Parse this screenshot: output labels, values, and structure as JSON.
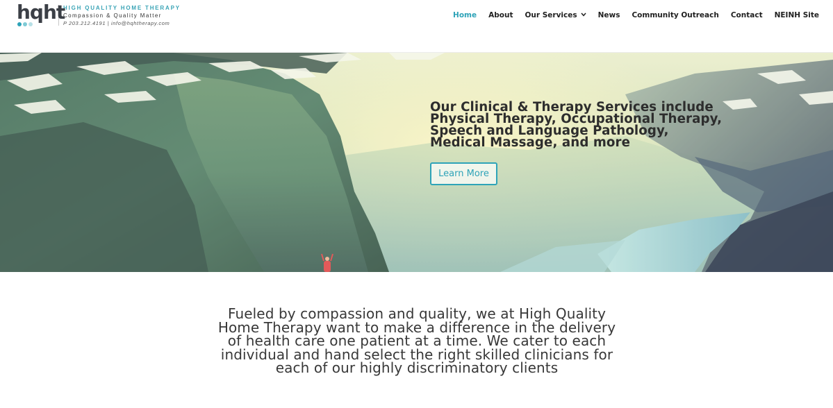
{
  "brand": {
    "logo_letters": "hqht",
    "name": "HIGH QUALITY HOME THERAPY",
    "tagline": "Compassion & Quality Matter",
    "contact": "P 203.212.4191 | info@hqhtherapy.com",
    "dot_colors": [
      "#2ea3b8",
      "#7fcbd6",
      "#b7e0e6"
    ]
  },
  "nav": {
    "items": [
      {
        "label": "Home",
        "active": true
      },
      {
        "label": "About"
      },
      {
        "label": "Our Services",
        "has_dropdown": true
      },
      {
        "label": "News"
      },
      {
        "label": "Community Outreach"
      },
      {
        "label": "Contact"
      },
      {
        "label": "NEINH Site"
      }
    ],
    "dropdown_icon": "chevron-down-icon"
  },
  "hero": {
    "heading_lines": [
      "Our Clinical & Therapy Services include",
      "Physical Therapy, Occupational Therapy,",
      "Speech and Language Pathology,",
      "Medical Massage, and more"
    ],
    "button_label": "Learn More"
  },
  "mission": {
    "lines": [
      "Fueled by compassion and quality, we at High Quality",
      "Home Therapy want to make a difference in the delivery",
      "of health care one patient at a time. We cater to each",
      "individual and hand select the right skilled clinicians for",
      "each of our highly discriminatory clients"
    ]
  },
  "colors": {
    "accent": "#2ea3b8",
    "nav_text": "#1f1f1f",
    "heading_text": "#2d2d2d",
    "body_text": "#383838"
  }
}
